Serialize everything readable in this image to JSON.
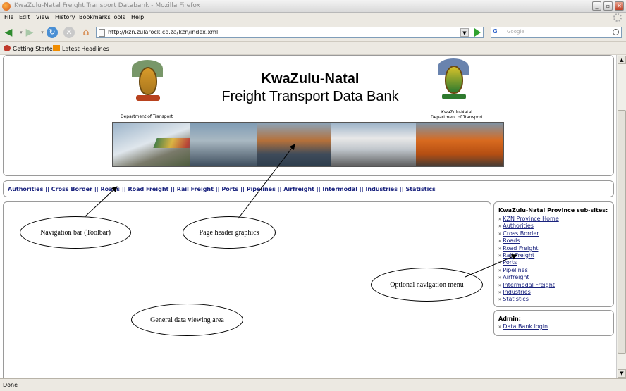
{
  "window": {
    "title": "KwaZulu-Natal Freight Transport Databank - Mozilla Firefox"
  },
  "menu": [
    "File",
    "Edit",
    "View",
    "History",
    "Bookmarks",
    "Tools",
    "Help"
  ],
  "navbar": {
    "url": "http://kzn.zularock.co.za/kzn/index.xml",
    "search_engine": "G",
    "search_placeholder": "Google"
  },
  "bookmarks": [
    "Getting Started",
    "Latest Headlines"
  ],
  "header": {
    "title_line1": "KwaZulu-Natal",
    "title_line2": "Freight Transport Data Bank",
    "dept_left": "Department of Transport",
    "dept_right_line1": "KwaZulu-Natal",
    "dept_right_line2": "Department of Transport"
  },
  "toolbar": {
    "links": [
      "Authorities",
      "Cross Border",
      "Roads",
      "Road Freight",
      "Rail Freight",
      "Ports",
      "Pipelines",
      "Airfreight",
      "Intermodal",
      "Industries",
      "Statistics"
    ],
    "separator": "||"
  },
  "subsites": {
    "heading": "KwaZulu-Natal Province sub-sites:",
    "items": [
      "KZN Province Home",
      "Authorities",
      "Cross Border",
      "Roads",
      "Road Freight",
      "Rail Freight",
      "Ports",
      "Pipelines",
      "Airfreight",
      "Intermodal Freight",
      "Industries",
      "Statistics"
    ]
  },
  "admin": {
    "heading": "Admin:",
    "items": [
      "Data Bank login"
    ]
  },
  "annotations": {
    "nav_bar": "Navigation bar (Toolbar)",
    "page_header": "Page header graphics",
    "optional_menu": "Optional navigation menu",
    "data_area": "General data viewing area"
  },
  "status": {
    "text": "Done"
  },
  "colors": {
    "link": "#1a237e",
    "go_arrow": "#2ea12e"
  },
  "icons": {
    "back": "back-arrow-icon",
    "forward": "forward-arrow-icon",
    "reload": "reload-icon",
    "stop": "stop-icon",
    "home": "home-icon"
  }
}
